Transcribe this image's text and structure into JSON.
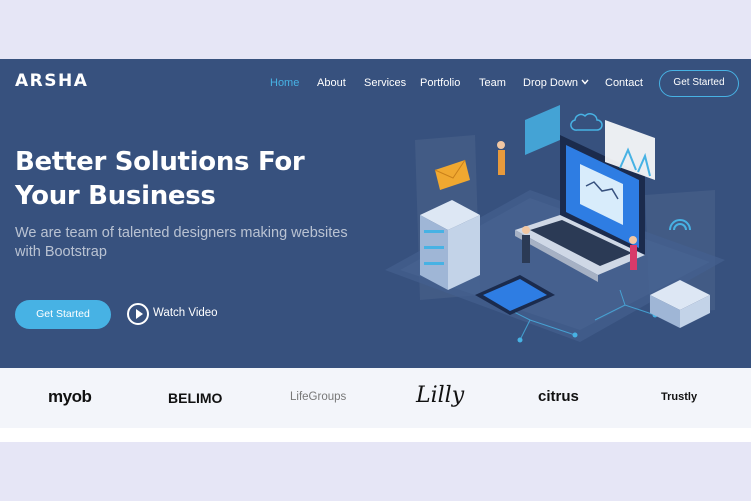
{
  "brand": {
    "logo_text": "ARSHA"
  },
  "nav": {
    "items": [
      {
        "label": "Home",
        "active": true
      },
      {
        "label": "About"
      },
      {
        "label": "Services"
      },
      {
        "label": "Portfolio"
      },
      {
        "label": "Team"
      },
      {
        "label": "Drop Down",
        "has_dropdown": true
      },
      {
        "label": "Contact"
      }
    ],
    "cta_label": "Get Started"
  },
  "hero": {
    "title_line1": "Better Solutions For",
    "title_line2": "Your Business",
    "subtitle_line1": "We are team of talented designers making websites",
    "subtitle_line2": "with Bootstrap",
    "cta_label": "Get Started",
    "watch_label": "Watch Video"
  },
  "clients": [
    {
      "name": "myob"
    },
    {
      "name": "BELIMO"
    },
    {
      "name": "LifeGroups"
    },
    {
      "name": "Lilly"
    },
    {
      "name": "citrus"
    },
    {
      "name": "Trustly"
    }
  ],
  "colors": {
    "hero_bg": "#37517e",
    "accent": "#47b2e4",
    "page_bg": "#e6e6f6",
    "clients_bg": "#f3f5fa"
  },
  "icons": [
    "chevron-down-icon",
    "play-icon",
    "illustration-laptop-servers"
  ]
}
